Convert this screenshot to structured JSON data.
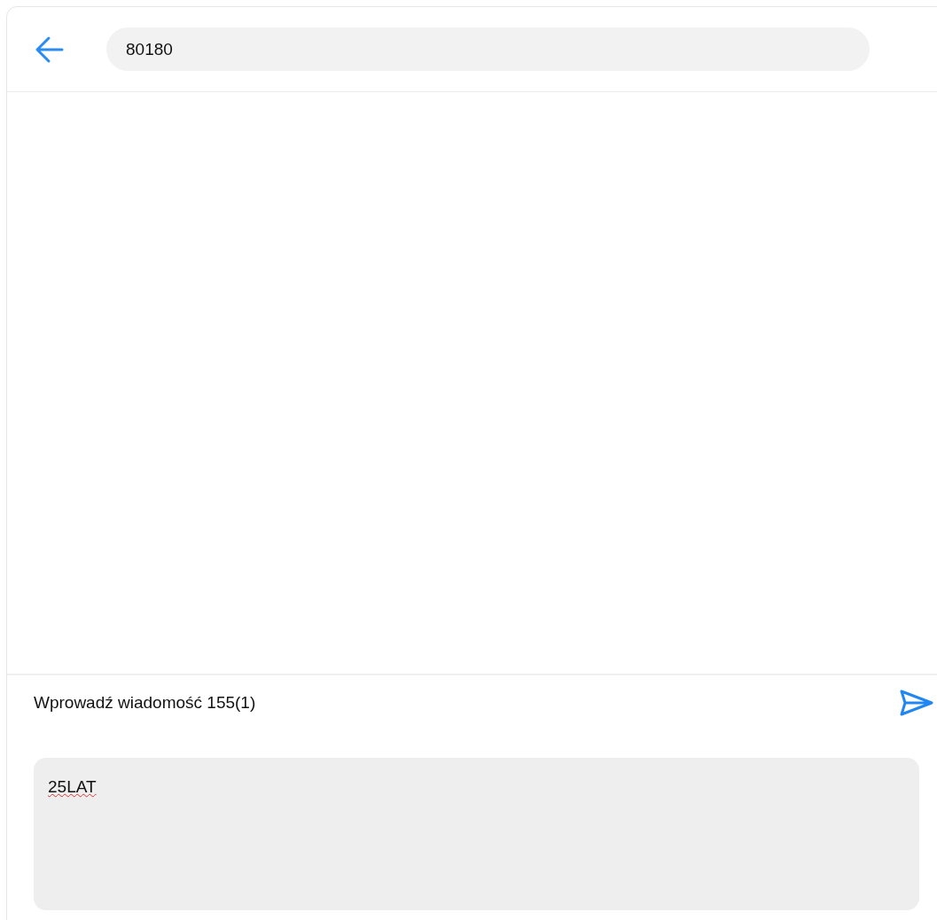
{
  "header": {
    "title": "80180"
  },
  "composer": {
    "label": "Wprowadź wiadomość 155(1)",
    "message": "25LAT"
  }
}
